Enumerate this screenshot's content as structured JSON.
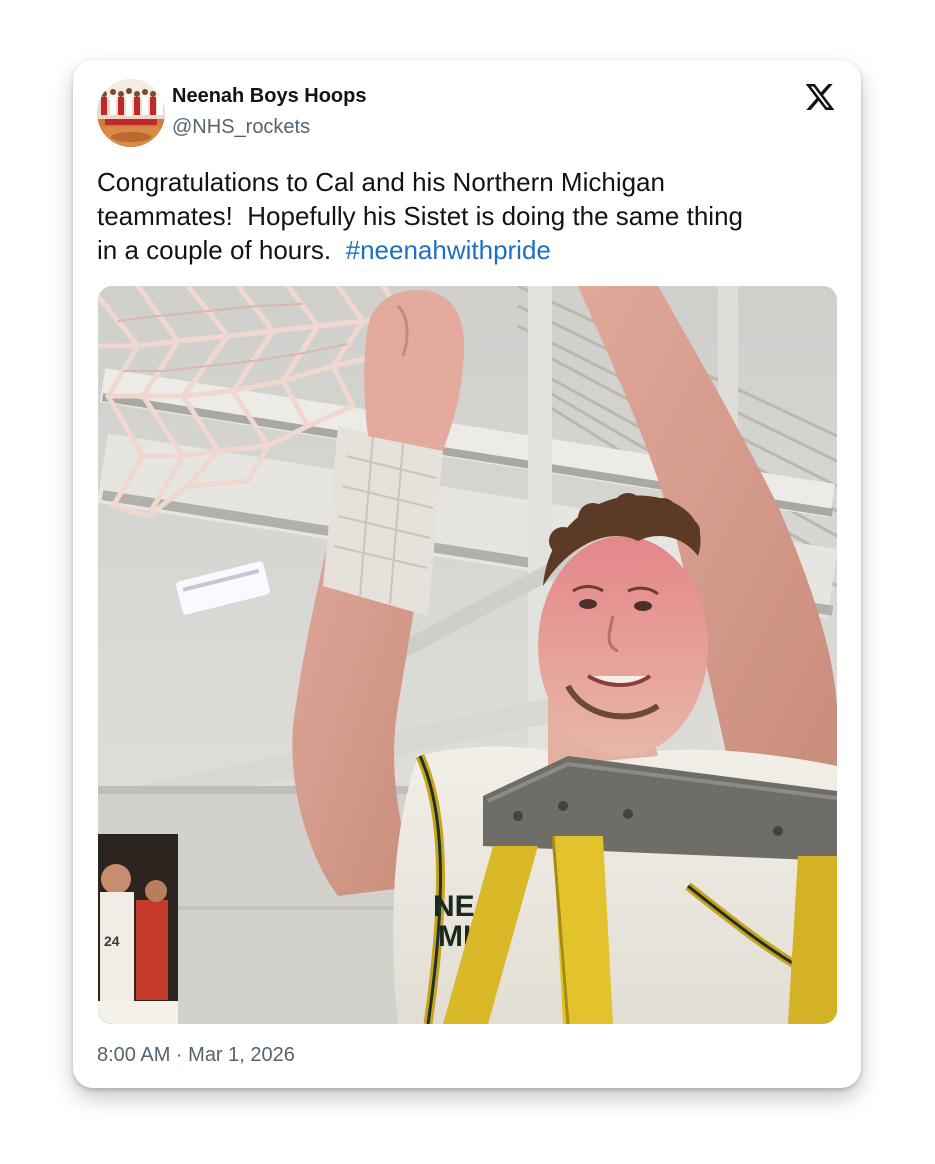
{
  "account": {
    "display_name": "Neenah Boys Hoops",
    "handle": "@NHS_rockets",
    "avatar_icon": "team-photo-avatar"
  },
  "platform_icon": "x-logo-icon",
  "tweet": {
    "lines": [
      "Congratulations to Cal and his Northern Michigan",
      "teammates!  Hopefully his Sistet is doing the same thing",
      "in a couple of hours.  "
    ],
    "hashtag": "#neenahwithpride"
  },
  "media": {
    "jersey_number": "24"
  },
  "timestamp": "8:00 AM · Mar 1, 2026",
  "colors": {
    "text": "#0f1419",
    "secondary": "#536471",
    "hashtag": "#1d70c1"
  }
}
